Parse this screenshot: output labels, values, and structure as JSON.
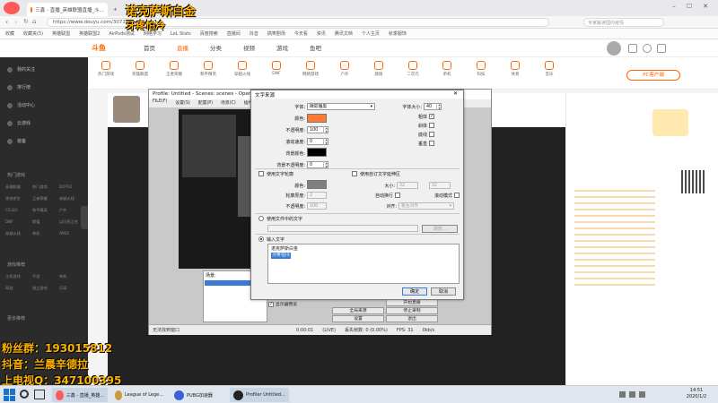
{
  "browser": {
    "tabs": [
      {
        "label": "三鑫 - 直播_英雄联盟直播_斗..."
      },
      {
        "label": "+"
      }
    ],
    "url": "https://www.douyu.com/307322",
    "search_placeholder": "专家解读国内疫情",
    "bookmarks": [
      "收藏",
      "收藏夹(5)",
      "英雄联盟",
      "英雄联盟2",
      "AirPods测试",
      "网络学习",
      "LoL Stats",
      "百度搜索",
      "直播间",
      "抖音",
      "搞笑剧场",
      "今天看",
      "资讯",
      "腾讯文档",
      "个人主页",
      "秋季服饰"
    ]
  },
  "site": {
    "logo": "斗鱼",
    "nav": [
      "首页",
      "直播",
      "分类",
      "视频",
      "游戏",
      "鱼吧"
    ],
    "nav_active": "直播",
    "categories": [
      "热门游戏",
      "英雄联盟",
      "王者荣耀",
      "和平精英",
      "穿越火线",
      "DNF",
      "网络游戏",
      "户外",
      "颜值",
      "二次元",
      "单机",
      "科技",
      "体育",
      "音乐"
    ],
    "pc_client": "PC客户端"
  },
  "sidebar": {
    "items": [
      "我的关注",
      "排行榜",
      "活动中心",
      "云游戏",
      "装备"
    ],
    "games_title": "热门游戏",
    "games": [
      "英雄联盟",
      "热门游戏",
      "DOTA2",
      "绝地求生",
      "王者荣耀",
      "穿越火线",
      "CS:GO",
      "和平精英",
      "户外",
      "DNF",
      "颜值",
      "以闪亮之名",
      "穿越火线",
      "单机",
      "APEX"
    ],
    "section2": "游戏推荐",
    "games2": [
      "主机游戏",
      "手游",
      "单机",
      "网游",
      "独立游戏",
      "乐高"
    ],
    "section3": "更多推荐"
  },
  "obs": {
    "title": "Profile: Untitled - Scenes: scenes - Open Broadcaster Software v0.659b",
    "menu": [
      "FILE(F)",
      "设置(S)",
      "配置(P)",
      "场景(C)",
      "插件(L)",
      "帮助(H)"
    ],
    "scenes_label": "场景:",
    "preview_label": "显示器预览",
    "buttons": [
      "全局来源",
      "设置",
      "开始直播",
      "停止录制",
      "编辑场景",
      "退出",
      "预览直播",
      "开始录制",
      "插件"
    ],
    "status": [
      "无法找到窗口",
      "0:00:01",
      "(LIVE)",
      "丢失帧数: 0 (0.00%)",
      "FPS: 31",
      "0kb/s"
    ]
  },
  "dialog": {
    "title": "文字来源",
    "font_label": "字体:",
    "font_value": "微软雅黑",
    "color_label": "颜色:",
    "opacity_label": "不透明度:",
    "opacity_value": "100",
    "scroll_label": "滚动速度:",
    "scroll_value": "0",
    "bg_color_label": "背景颜色:",
    "bg_opacity_label": "背景不透明度:",
    "bg_opacity_value": "0",
    "font_size_label": "字体大小:",
    "font_size_value": "40",
    "bold_label": "粗体",
    "italic_label": "斜体",
    "underline_label": "底线",
    "vertical_label": "垂直",
    "outline_check": "使用文字轮廓",
    "outline_color_label": "颜色:",
    "outline_thickness_label": "轮廓厚度:",
    "outline_thickness_value": "2",
    "outline_opacity_label": "不透明度:",
    "outline_opacity_value": "100",
    "custom_area": "使用自订文字延伸区",
    "size_label": "大小:",
    "size_w": "32",
    "size_h": "32",
    "wrap_label": "自动换行",
    "scroll_mode_label": "滚动模式",
    "align_label": "对齐:",
    "align_value": "靠左对齐",
    "use_file_label": "使用文件中的文字",
    "browse_label": "浏览...",
    "input_label": "输入文字",
    "text_line1": "诺克萨斯白金",
    "text_line2": "牙疼怕冷",
    "ok": "确定",
    "cancel": "取消",
    "colors": {
      "text": "#ff7a33",
      "bg": "#000000",
      "outline": "#808080"
    },
    "bold": true,
    "italic": false,
    "underline": false,
    "vertical": false
  },
  "overlay": {
    "top_title": "诺克萨斯白金",
    "top_sub": "牙疼怕冷",
    "fans": "粉丝群：193015812",
    "douyin": "抖音：兰晨辛德拉",
    "qq": "上电视Q：347100395",
    "color": "#ffb300"
  },
  "taskbar": {
    "items": [
      "三鑫 - 直播_英雄...",
      "League of Lege...",
      "PUBG加速器",
      "Profiler Untitled..."
    ],
    "time": "14:51",
    "date": "2020/1/2"
  }
}
